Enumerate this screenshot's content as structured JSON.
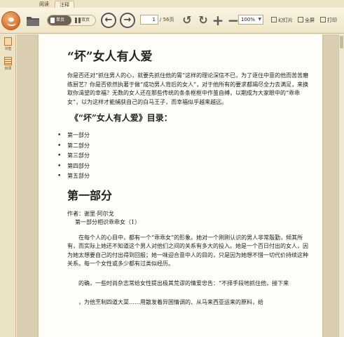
{
  "tabs": [
    {
      "label": "阅读"
    },
    {
      "label": "注释"
    }
  ],
  "toolbar": {
    "single_page_label": "单页",
    "double_page_label": "双页",
    "current_page": "1",
    "total_pages": "/ 56页",
    "zoom_value": "100%",
    "slides_label": "幻灯片",
    "fullscreen_label": "全屏",
    "print_label": "打印",
    "icons": {
      "folder": "folder-icon",
      "prev": "arrow-left-icon",
      "next": "arrow-right-icon",
      "rotate_left": "rotate-left-icon",
      "rotate_right": "rotate-right-icon",
      "zoom_in": "plus-icon",
      "zoom_out": "minus-icon"
    }
  },
  "sidebar": {
    "items": [
      {
        "label": "书签",
        "icon": "bookmark-icon"
      },
      {
        "label": "目录",
        "icon": "toc-icon"
      }
    ]
  },
  "document": {
    "title": "“坏”女人有人爱",
    "intro": "你是否还对“抓住男人的心，就要先抓住他的胃”这样的理论深信不已，为了逐住中意的他而苦苦磨练厨艺？你是否依然执著于做“成功男人背后的女人”，对于他所有的要求都竭尽全力去满足，来换取你渴望的幸福？无数的女人还在那些传统的条条框框中作茧自缚，以期成为大家眼中的“乖乖女”，以为这样才能捕获自己的白马王子，而幸福似乎越来越远。",
    "toc_heading": "《“坏”女人有人爱》目录：",
    "toc": [
      "第一部分",
      "第二部分",
      "第三部分",
      "第四部分",
      "第五部分"
    ],
    "part_title": "第一部分",
    "author": "作者：谢里·阿尔戈",
    "subtitle": "第一部分相识乖乖女（1）",
    "paragraphs": [
      "在每个人的心目中，都有一个“乖乖女”的形象。她对一个刚刚认识的男人非常殷勤，倾其所有，而实际上她还不知道这个男人对他们之间的关系有多大的投入。她是一个百日付出的女人，因为她太想要自己的付出得到回报；她一味迎合意中人的目的，只是因为她想不惜一切代价持续这种关系。每一个女性或多少都有过类似经历。",
      "的确，一些时尚杂志常给女性提出极其荒谬的情爱忠告：“不择手段地抓住他，接下来",
      "，为他烹制四道大菜……用散发着异国情调的、从马来西亚运来的原料，给"
    ]
  }
}
